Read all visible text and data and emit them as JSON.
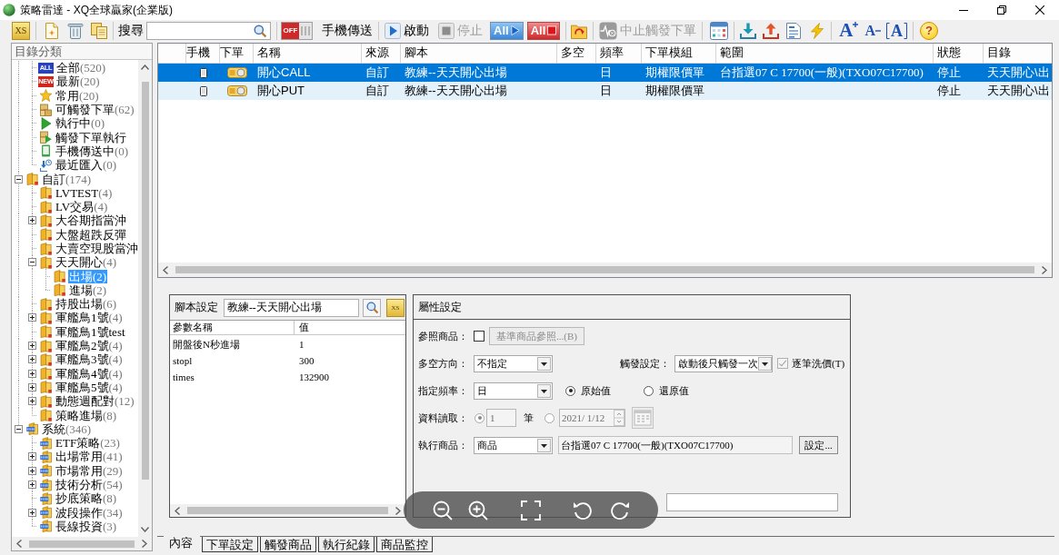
{
  "window": {
    "title": "策略雷達 - XQ全球贏家(企業版)"
  },
  "toolbar": [
    {
      "kind": "xs",
      "label": "XS"
    },
    {
      "kind": "separator"
    },
    {
      "kind": "new"
    },
    {
      "kind": "delete"
    },
    {
      "kind": "copy"
    },
    {
      "kind": "separator"
    },
    {
      "kind": "search",
      "label": "搜尋"
    },
    {
      "kind": "separator"
    },
    {
      "kind": "toggle",
      "on": false,
      "state": "OFF",
      "label": "手機傳送"
    },
    {
      "kind": "separator"
    },
    {
      "kind": "start",
      "label": "啟動",
      "disabled": false
    },
    {
      "kind": "stop",
      "label": "停止",
      "disabled": true
    },
    {
      "kind": "all-start",
      "label": "All"
    },
    {
      "kind": "all-stop",
      "label": "All"
    },
    {
      "kind": "separator"
    },
    {
      "kind": "folder"
    },
    {
      "kind": "separator"
    },
    {
      "kind": "halt",
      "label": "中止觸發下單",
      "disabled": true
    },
    {
      "kind": "separator"
    },
    {
      "kind": "calendar"
    },
    {
      "kind": "separator"
    },
    {
      "kind": "download"
    },
    {
      "kind": "upload"
    },
    {
      "kind": "report"
    },
    {
      "kind": "lightning"
    },
    {
      "kind": "separator"
    },
    {
      "kind": "font-larger",
      "label": "A"
    },
    {
      "kind": "font-smaller",
      "label": "A"
    },
    {
      "kind": "font-reset",
      "label": "A"
    },
    {
      "kind": "separator"
    },
    {
      "kind": "help",
      "label": "?"
    }
  ],
  "sidebar": {
    "header": "目錄分類",
    "categories": [
      {
        "label": "全部",
        "count": "(520)",
        "kind": "badge",
        "badge": "ALL",
        "color": "#2741c4",
        "selected": false
      },
      {
        "label": "最新",
        "count": "(20)",
        "kind": "badge",
        "badge": "NEW",
        "color": "#d0261c",
        "selected": false
      },
      {
        "label": "常用",
        "count": "(20)",
        "kind": "star",
        "selected": false
      },
      {
        "label": "可觸發下單",
        "count": "(62)",
        "kind": "coins",
        "selected": false
      },
      {
        "label": "執行中",
        "count": "(0)",
        "kind": "play",
        "selected": false
      },
      {
        "label": "觸發下單執行",
        "kind": "coins-play",
        "selected": false
      },
      {
        "label": "手機傳送中",
        "count": "(0)",
        "kind": "phone",
        "selected": false
      },
      {
        "label": "最近匯入",
        "count": "(0)",
        "kind": "import",
        "selected": false
      }
    ],
    "folders": [
      {
        "label": "自訂",
        "count": "(174)",
        "kind": "folder",
        "expanded": true,
        "selected": false,
        "children": [
          {
            "label": "LVTEST",
            "count": "(4)",
            "kind": "folder",
            "selected": false
          },
          {
            "label": "LV交易",
            "count": "(4)",
            "kind": "folder",
            "selected": false
          },
          {
            "label": "大谷期指當沖",
            "kind": "folder",
            "expanded": false,
            "selected": false
          },
          {
            "label": "大盤超跌反彈",
            "kind": "folder",
            "selected": false
          },
          {
            "label": "大賣空現股當沖",
            "kind": "folder",
            "selected": false
          },
          {
            "label": "天天開心",
            "count": "(4)",
            "kind": "folder",
            "expanded": true,
            "selected": false,
            "children": [
              {
                "label": "出場",
                "count": "(2)",
                "kind": "folder",
                "selected": true
              },
              {
                "label": "進場",
                "count": "(2)",
                "kind": "folder",
                "selected": false
              }
            ]
          },
          {
            "label": "持股出場",
            "count": "(6)",
            "kind": "folder",
            "selected": false
          },
          {
            "label": "軍艦鳥1號",
            "count": "(4)",
            "kind": "folder",
            "expanded": false,
            "selected": false
          },
          {
            "label": "軍艦鳥1號test",
            "kind": "folder",
            "selected": false
          },
          {
            "label": "軍艦鳥2號",
            "count": "(4)",
            "kind": "folder",
            "expanded": false,
            "selected": false
          },
          {
            "label": "軍艦鳥3號",
            "count": "(4)",
            "kind": "folder",
            "expanded": false,
            "selected": false
          },
          {
            "label": "軍艦鳥4號",
            "count": "(4)",
            "kind": "folder",
            "expanded": false,
            "selected": false
          },
          {
            "label": "軍艦鳥5號",
            "count": "(4)",
            "kind": "folder",
            "expanded": false,
            "selected": false
          },
          {
            "label": "動態週配對",
            "count": "(12)",
            "kind": "folder",
            "expanded": false,
            "selected": false
          },
          {
            "label": "策略進場",
            "count": "(8)",
            "kind": "folder",
            "selected": false
          }
        ]
      },
      {
        "label": "系統",
        "count": "(346)",
        "kind": "system",
        "expanded": true,
        "selected": false,
        "children": [
          {
            "label": "ETF策略",
            "count": "(23)",
            "kind": "system",
            "selected": false
          },
          {
            "label": "出場常用",
            "count": "(41)",
            "kind": "system",
            "expanded": false,
            "selected": false
          },
          {
            "label": "市場常用",
            "count": "(29)",
            "kind": "system",
            "expanded": false,
            "selected": false
          },
          {
            "label": "技術分析",
            "count": "(54)",
            "kind": "system",
            "expanded": false,
            "selected": false
          },
          {
            "label": "抄底策略",
            "count": "(8)",
            "kind": "system",
            "selected": false
          },
          {
            "label": "波段操作",
            "count": "(34)",
            "kind": "system",
            "expanded": false,
            "selected": false
          },
          {
            "label": "長線投資",
            "count": "(3)",
            "kind": "system",
            "selected": false
          }
        ]
      }
    ]
  },
  "table": {
    "columns": [
      "手機",
      "下單",
      "名稱",
      "來源",
      "腳本",
      "多空",
      "頻率",
      "下單模組",
      "範圍",
      "狀態",
      "目錄"
    ],
    "rows": [
      {
        "selected": true,
        "name": "開心CALL",
        "source": "自訂",
        "script": "教練--天天開心出場",
        "frequency": "日",
        "module": "期權限價單",
        "range": "台指選07 C 17700(一般)(TXO07C17700)",
        "status": "停止",
        "folder": "天天開心\\出"
      },
      {
        "selected": false,
        "name": "開心PUT",
        "source": "自訂",
        "script": "教練--天天開心出場",
        "frequency": "日",
        "module": "期權限價單",
        "status": "停止",
        "folder": "天天開心\\出"
      }
    ]
  },
  "script_panel": {
    "label": "腳本設定",
    "script": "教練--天天開心出場",
    "badge": "XS",
    "columns": [
      "參數名稱",
      "值"
    ],
    "params": [
      {
        "name": "開盤後N秒進場",
        "value": "1"
      },
      {
        "name": "stopl",
        "value": "300"
      },
      {
        "name": "times",
        "value": "132900"
      }
    ]
  },
  "properties": {
    "title": "屬性設定",
    "reference": {
      "label": "參照商品：",
      "checked": false,
      "button": "基準商品參照...(B)",
      "disabled": true
    },
    "direction": {
      "label": "多空方向：",
      "value": "不指定"
    },
    "trigger": {
      "label": "觸發設定：",
      "value": "啟動後只觸發一次",
      "option": {
        "label": "逐筆洗價(T)",
        "checked": true,
        "disabled": true
      }
    },
    "frequency": {
      "label": "指定頻率：",
      "value": "日",
      "options": [
        {
          "label": "原始值",
          "selected": true
        },
        {
          "label": "還原值",
          "selected": false
        }
      ]
    },
    "data_read": {
      "label": "資料讀取：",
      "disabled": true,
      "options": [
        {
          "kind": "count",
          "selected": true,
          "value": "1",
          "unit": "筆"
        },
        {
          "kind": "date",
          "selected": false,
          "value": "2021/ 1/12"
        }
      ]
    },
    "product": {
      "label": "執行商品：",
      "value": "商品",
      "symbol": "台指選07 C 17700(一般)(TXO07C17700)",
      "button": "設定..."
    }
  },
  "tabs": [
    {
      "label": "內容",
      "selected": true
    },
    {
      "label": "下單設定",
      "selected": false
    },
    {
      "label": "觸發商品",
      "selected": false
    },
    {
      "label": "執行紀錄",
      "selected": false
    },
    {
      "label": "商品監控",
      "selected": false
    }
  ],
  "viewer_controls": [
    {
      "kind": "zoom-out"
    },
    {
      "kind": "zoom-in"
    },
    {
      "kind": "fullscreen"
    },
    {
      "kind": "rotate-left"
    },
    {
      "kind": "rotate-right"
    }
  ]
}
